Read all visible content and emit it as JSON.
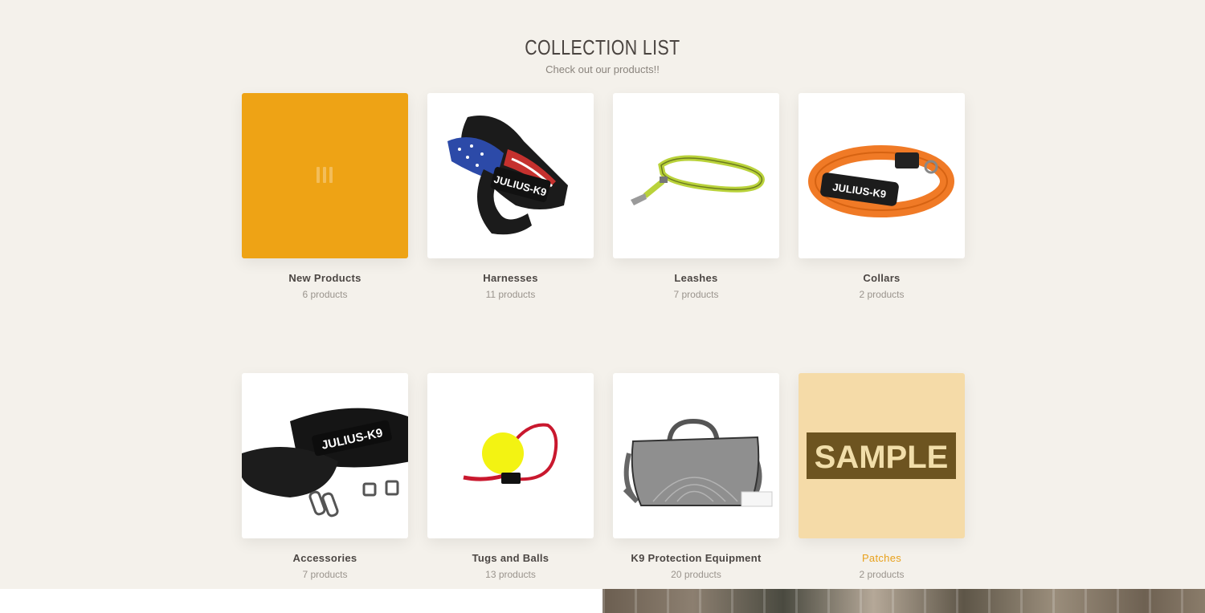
{
  "section": {
    "title": "COLLECTION LIST",
    "subtitle": "Check out our products!!"
  },
  "collections": [
    {
      "name": "New Products",
      "count": "6 products"
    },
    {
      "name": "Harnesses",
      "count": "11 products"
    },
    {
      "name": "Leashes",
      "count": "7 products"
    },
    {
      "name": "Collars",
      "count": "2 products"
    },
    {
      "name": "Accessories",
      "count": "7 products"
    },
    {
      "name": "Tugs and Balls",
      "count": "13 products"
    },
    {
      "name": "K9 Protection Equipment",
      "count": "20 products"
    },
    {
      "name": "Patches",
      "count": "2 products"
    }
  ],
  "brand_text": "JULIUS-K9",
  "patch_text": "SAMPLE",
  "colors": {
    "background": "#f4f1eb",
    "accent": "#e8a11c",
    "new_products_tile": "#eea315",
    "patches_tile": "#f5dba8"
  }
}
